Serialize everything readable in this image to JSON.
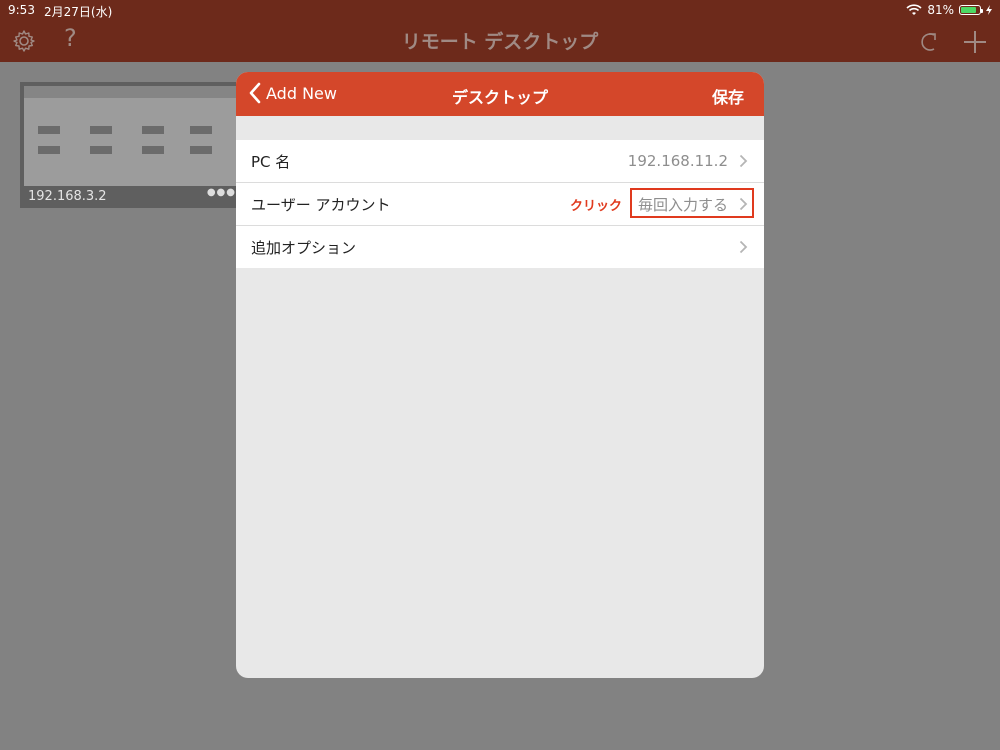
{
  "status_bar": {
    "time": "9:53",
    "date": "2月27日(水)",
    "battery_text": "81%",
    "battery_level": 0.81
  },
  "app": {
    "title": "リモート デスクトップ"
  },
  "saved_desktops": [
    {
      "label": "192.168.3.2"
    }
  ],
  "sheet": {
    "back_label": "Add New",
    "title": "デスクトップ",
    "save_label": "保存",
    "rows": [
      {
        "label": "PC 名",
        "value": "192.168.11.2"
      },
      {
        "label": "ユーザー アカウント",
        "value": "毎回入力する",
        "annotation": "クリック"
      },
      {
        "label": "追加オプション",
        "value": ""
      }
    ]
  },
  "colors": {
    "nav_red": "#d4472a",
    "annotation_red": "#e03a1e"
  }
}
